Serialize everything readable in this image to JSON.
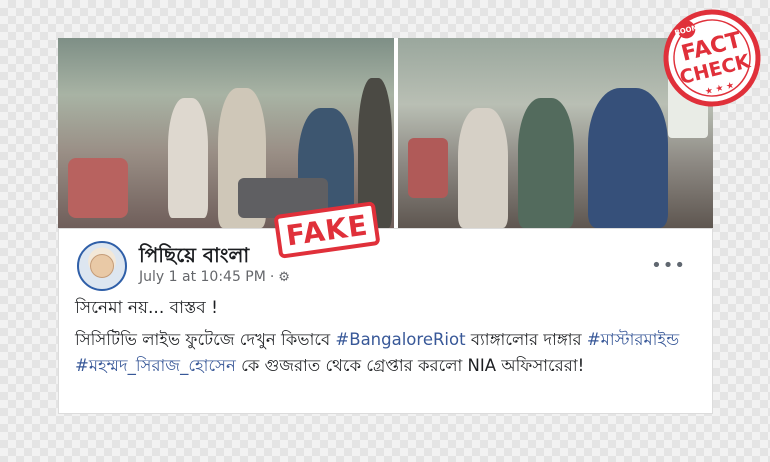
{
  "post": {
    "page_name": "পিছিয়ে বাংলা",
    "date": "July 1 at 10:45 PM",
    "dot": "·",
    "more_label": "•••",
    "headline": "সিনেমা নয়... বাস্তব !",
    "body_1": "সিসিটিভি লাইভ ফুটেজে দেখুন কিভাবে ",
    "hashtag_1": "#BangaloreRiot",
    "body_2": " ব্যাঙ্গালোর দাঙ্গার ",
    "hashtag_2": "#মাস্টারমাইন্ড",
    "body_3": " ",
    "hashtag_3": "#মহম্মদ_সিরাজ_হোসেন",
    "body_4": " কে গুজরাত থেকে গ্রেপ্তার করলো NIA অফিসারেরা!"
  },
  "stamp": {
    "fake_label": "FAKE"
  },
  "logo": {
    "top": "BOOM",
    "line1": "FACT",
    "line2": "CHECK",
    "stars": "★ ★ ★"
  },
  "colors": {
    "accent_red": "#e0303a",
    "link_blue": "#385898"
  },
  "icons": {
    "privacy": "gear-icon",
    "more": "more-icon"
  }
}
